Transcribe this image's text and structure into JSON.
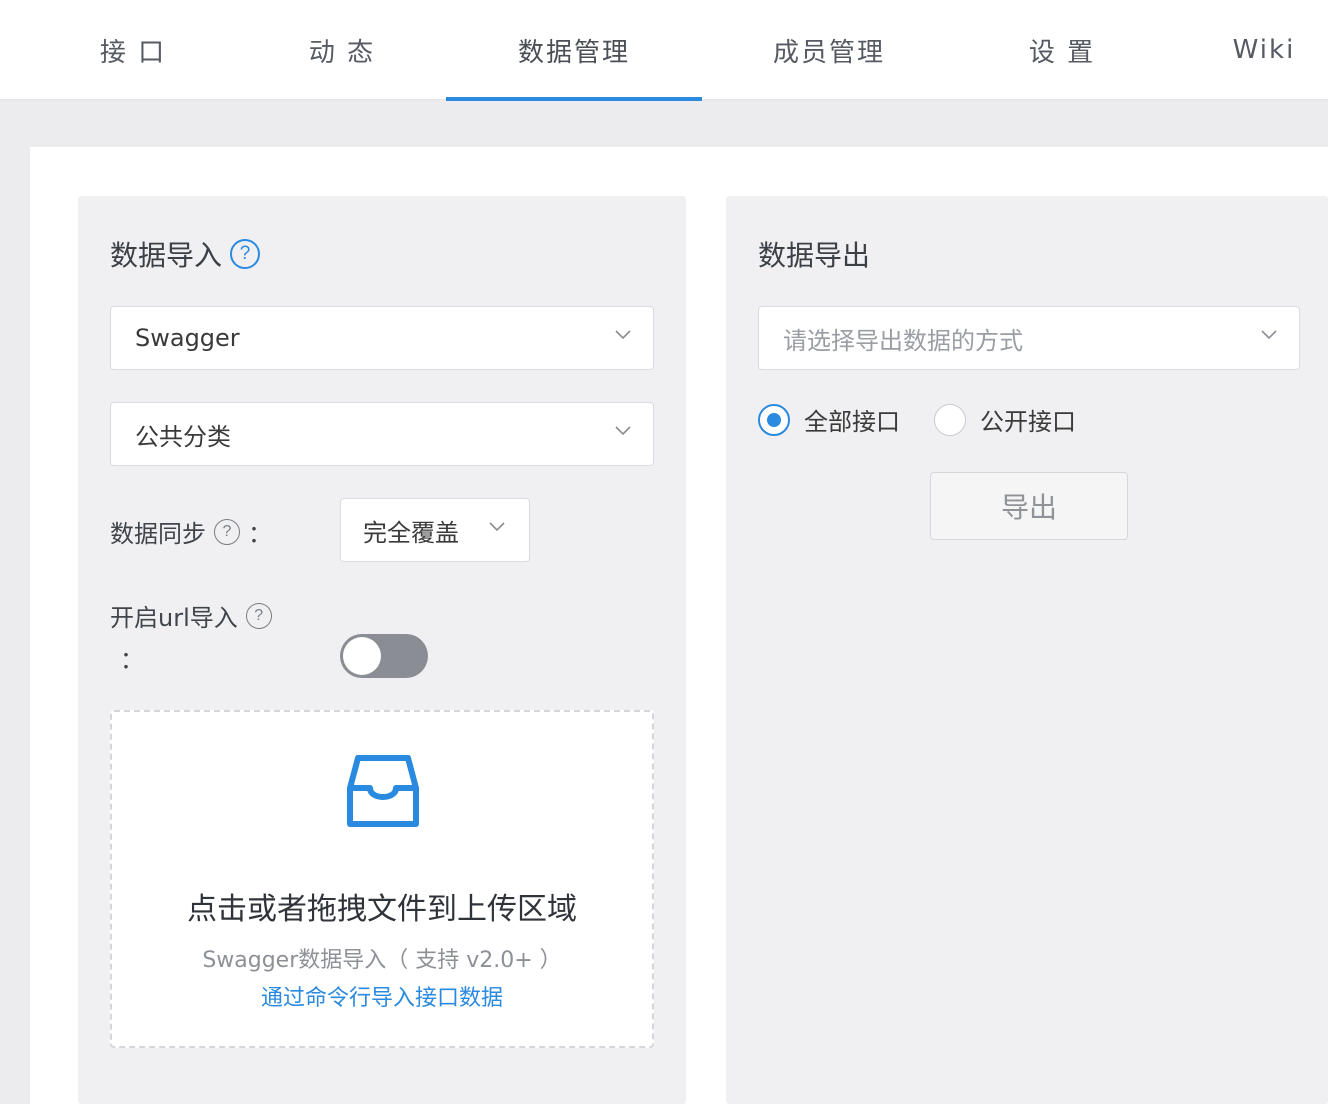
{
  "tabs": [
    {
      "label": "接 口"
    },
    {
      "label": "动 态"
    },
    {
      "label": "数据管理",
      "active": true
    },
    {
      "label": "成员管理"
    },
    {
      "label": "设 置"
    },
    {
      "label": "Wiki"
    }
  ],
  "import": {
    "title": "数据导入",
    "help_icon": "?",
    "type_select": {
      "value": "Swagger"
    },
    "category_select": {
      "value": "公共分类"
    },
    "sync_label": "数据同步",
    "sync_colon": "：",
    "sync_select": {
      "value": "完全覆盖"
    },
    "url_label": "开启url导入",
    "url_colon": "：",
    "url_toggle_on": false,
    "dropzone": {
      "icon": "inbox-icon",
      "title": "点击或者拖拽文件到上传区域",
      "hint": "Swagger数据导入（ 支持 v2.0+ ）",
      "link": "通过命令行导入接口数据"
    }
  },
  "export": {
    "title": "数据导出",
    "method_select": {
      "placeholder": "请选择导出数据的方式"
    },
    "radio_all": "全部接口",
    "radio_public": "公开接口",
    "selected_radio": "all",
    "export_button": "导出"
  },
  "colors": {
    "accent": "#2a8ae0",
    "background": "#ececef",
    "card": "#f0f0f2"
  }
}
